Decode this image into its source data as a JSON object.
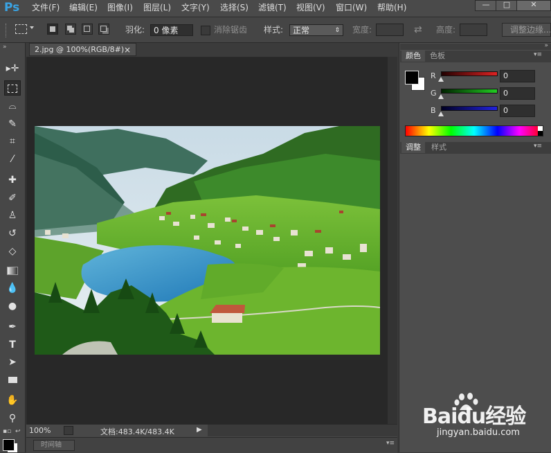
{
  "app": {
    "logo": "Ps"
  },
  "menu": [
    "文件(F)",
    "编辑(E)",
    "图像(I)",
    "图层(L)",
    "文字(Y)",
    "选择(S)",
    "滤镜(T)",
    "视图(V)",
    "窗口(W)",
    "帮助(H)"
  ],
  "window_buttons": {
    "minimize": "—",
    "maximize": "□",
    "close": "✕"
  },
  "options": {
    "feather_label": "羽化:",
    "feather_value": "0 像素",
    "antialias_label": "消除锯齿",
    "style_label": "样式:",
    "style_value": "正常",
    "width_label": "宽度:",
    "swap_icon": "⇄",
    "height_label": "高度:",
    "refine_button": "调整边缘..."
  },
  "document": {
    "tab_title": "2.jpg @ 100%(RGB/8#)",
    "tab_close": "×",
    "zoom": "100%",
    "doc_info": "文档:483.4K/483.4K",
    "status_arrow": "▶"
  },
  "timeline": {
    "label": "时间轴"
  },
  "color_panel": {
    "tab_active": "颜色",
    "tab_inactive": "色板",
    "r_label": "R",
    "g_label": "G",
    "b_label": "B",
    "r_value": "0",
    "g_value": "0",
    "b_value": "0",
    "foreground": "#000000",
    "background": "#ffffff"
  },
  "adjust_panel": {
    "tab_active": "调整",
    "tab_inactive": "样式"
  },
  "watermark": {
    "logo": "Baidu经验",
    "url": "jingyan.baidu.com"
  },
  "colors": {
    "accent": "#3aa3e3",
    "red_track": "#cc1f1f",
    "green_track": "#1fb81f",
    "blue_track": "#1f2fd0"
  }
}
